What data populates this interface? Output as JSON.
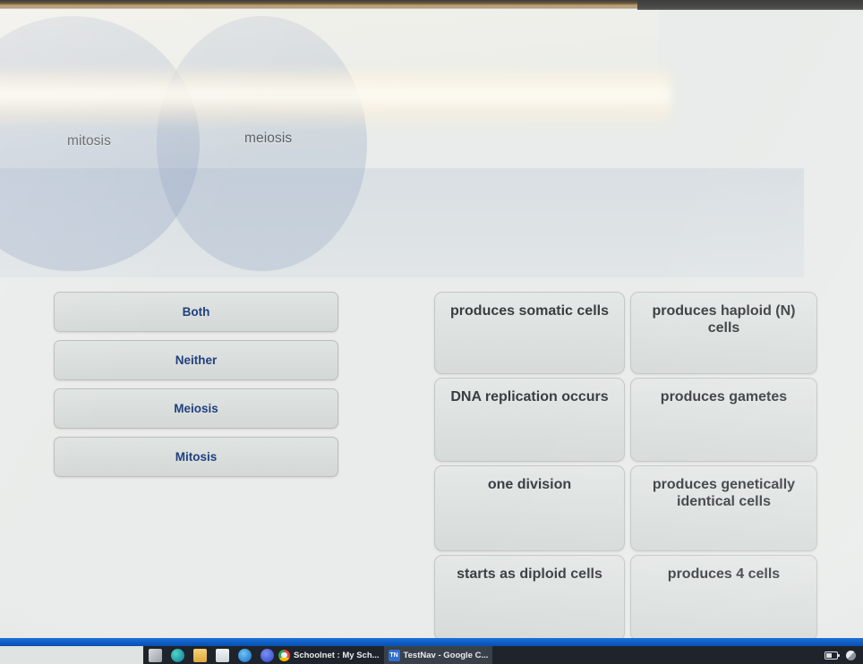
{
  "venn": {
    "left_label": "mitosis",
    "right_label": "meiosis"
  },
  "categories": [
    {
      "label": "Both"
    },
    {
      "label": "Neither"
    },
    {
      "label": "Meiosis"
    },
    {
      "label": "Mitosis"
    }
  ],
  "traits": [
    {
      "label": "produces somatic cells"
    },
    {
      "label": "produces haploid (N) cells"
    },
    {
      "label": "DNA replication occurs"
    },
    {
      "label": "produces gametes"
    },
    {
      "label": "one division"
    },
    {
      "label": "produces genetically identical cells"
    },
    {
      "label": "starts as diploid cells"
    },
    {
      "label": "produces 4 cells"
    }
  ],
  "taskbar": {
    "icons": [
      {
        "name": "start-windows-icon"
      },
      {
        "name": "edge-browser-icon"
      },
      {
        "name": "file-explorer-icon"
      },
      {
        "name": "microsoft-store-icon"
      },
      {
        "name": "onedrive-icon"
      },
      {
        "name": "teams-icon"
      }
    ],
    "windows": [
      {
        "title": "Schoolnet : My Sch...",
        "icon": "chrome-icon",
        "active": false
      },
      {
        "title": "TestNav - Google C...",
        "icon": "testnav-icon",
        "active": true,
        "badge": "TN"
      }
    ],
    "tray": [
      {
        "name": "battery-icon"
      },
      {
        "name": "sync-status-icon"
      }
    ]
  },
  "colors": {
    "page_background": "#e9ecea",
    "category_text": "#22407e",
    "trait_text": "#3a3d40",
    "venn_fill": "#96a6c4",
    "taskbar_background": "#1f232b",
    "window_border_blue": "#0f5ec4"
  }
}
